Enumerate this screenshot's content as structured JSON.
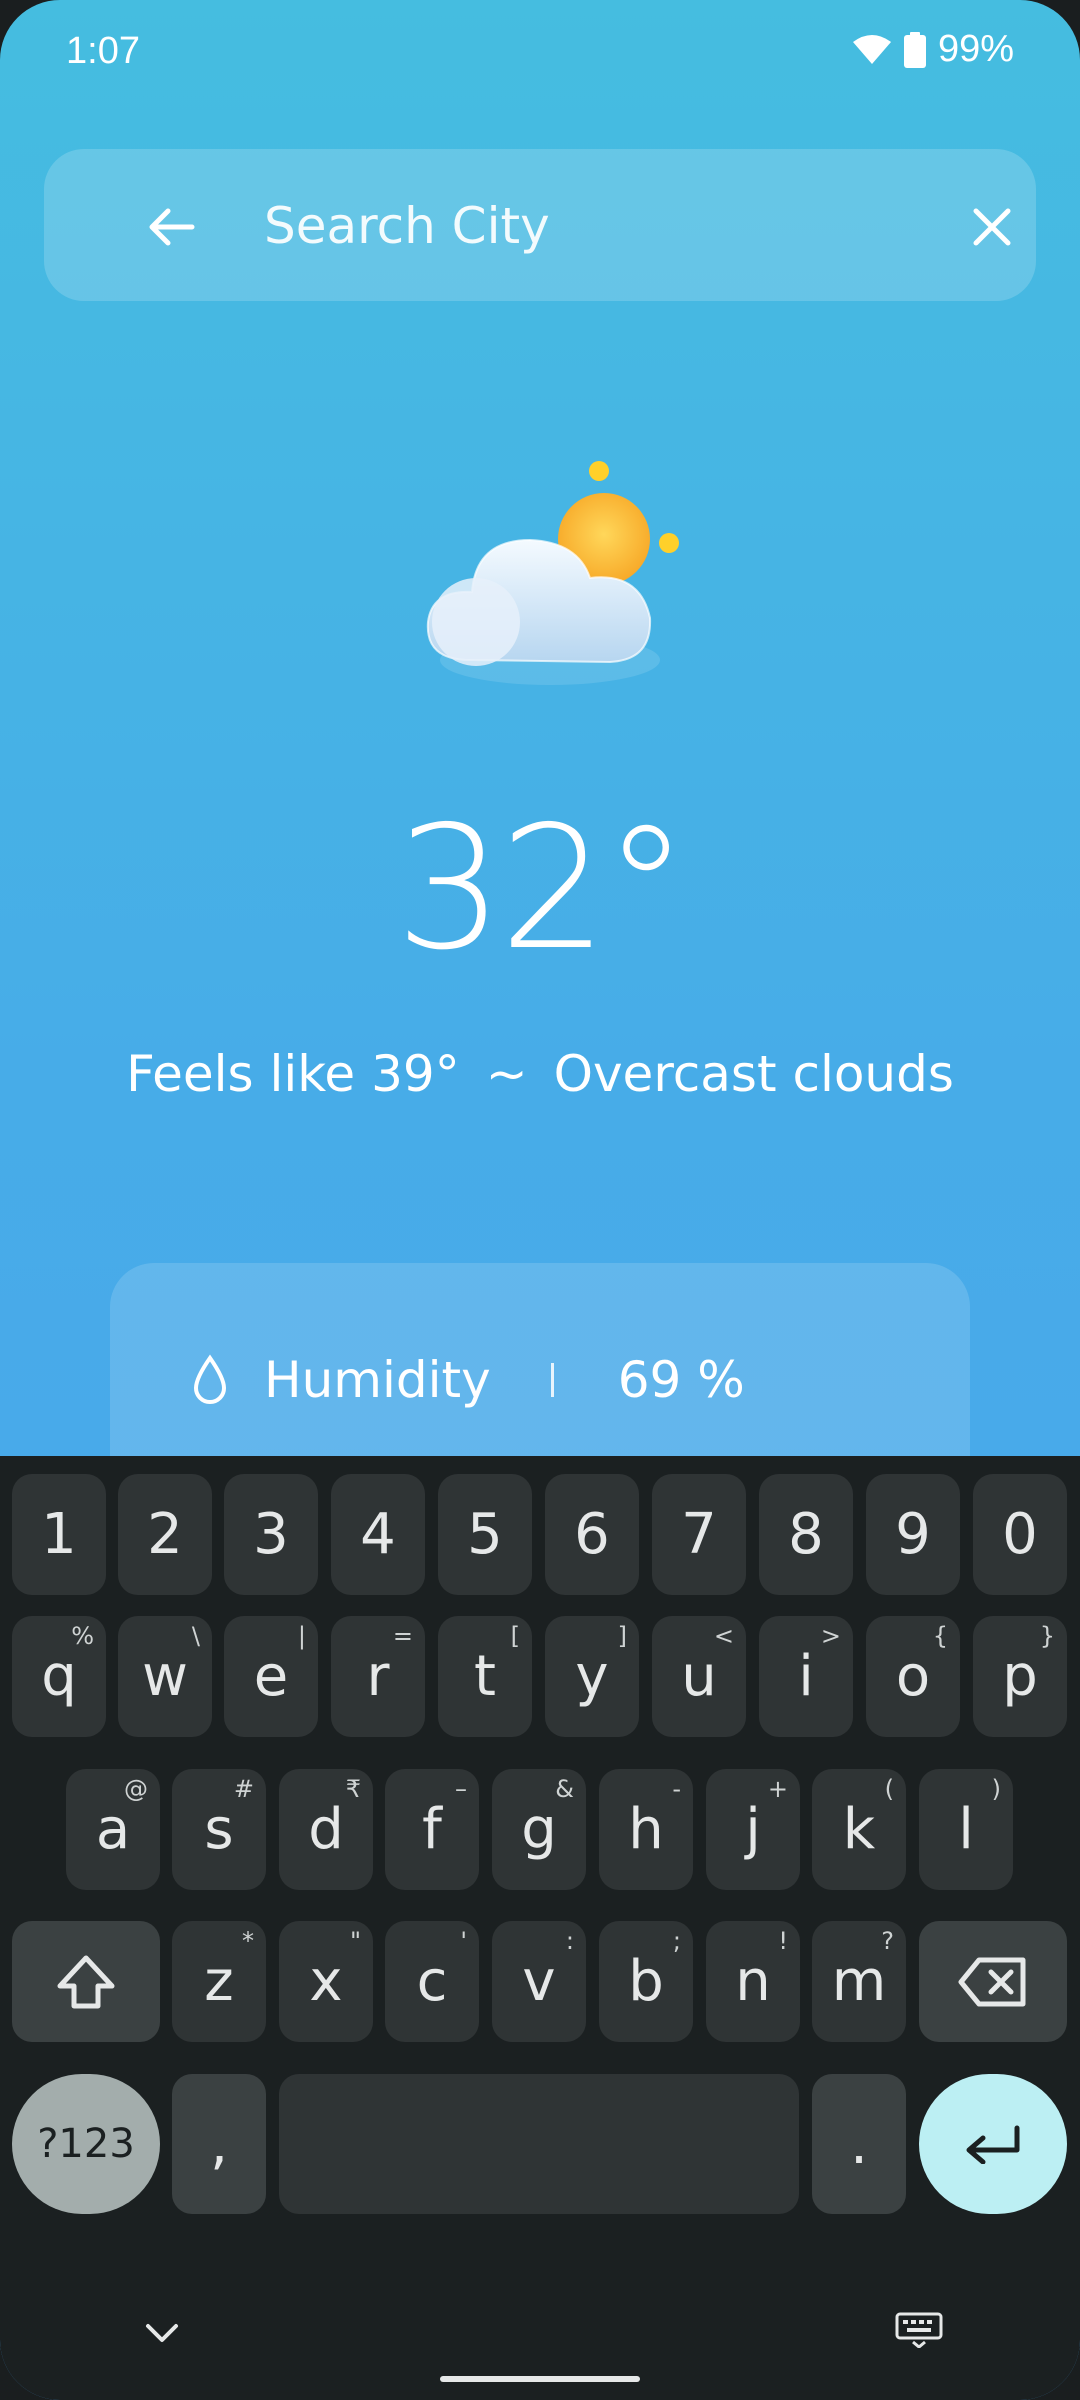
{
  "status_bar": {
    "time": "1:07",
    "battery": "99%"
  },
  "search": {
    "placeholder": "Search City",
    "value": ""
  },
  "weather": {
    "temperature": "32°",
    "feels_like": "Feels like 39°",
    "separator": "~",
    "condition": "Overcast clouds",
    "icon": "partly-cloudy-icon"
  },
  "details": {
    "humidity_label": "Humidity",
    "humidity_value": "69 %"
  },
  "keyboard": {
    "row1": [
      "1",
      "2",
      "3",
      "4",
      "5",
      "6",
      "7",
      "8",
      "9",
      "0"
    ],
    "row2": [
      {
        "key": "q",
        "hint": "%"
      },
      {
        "key": "w",
        "hint": "\\"
      },
      {
        "key": "e",
        "hint": "|"
      },
      {
        "key": "r",
        "hint": "="
      },
      {
        "key": "t",
        "hint": "["
      },
      {
        "key": "y",
        "hint": "]"
      },
      {
        "key": "u",
        "hint": "<"
      },
      {
        "key": "i",
        "hint": ">"
      },
      {
        "key": "o",
        "hint": "{"
      },
      {
        "key": "p",
        "hint": "}"
      }
    ],
    "row3": [
      {
        "key": "a",
        "hint": "@"
      },
      {
        "key": "s",
        "hint": "#"
      },
      {
        "key": "d",
        "hint": "₹"
      },
      {
        "key": "f",
        "hint": "–"
      },
      {
        "key": "g",
        "hint": "&"
      },
      {
        "key": "h",
        "hint": "-"
      },
      {
        "key": "j",
        "hint": "+"
      },
      {
        "key": "k",
        "hint": "("
      },
      {
        "key": "l",
        "hint": ")"
      }
    ],
    "row4": [
      {
        "key": "z",
        "hint": "*"
      },
      {
        "key": "x",
        "hint": "\""
      },
      {
        "key": "c",
        "hint": "'"
      },
      {
        "key": "v",
        "hint": ":"
      },
      {
        "key": "b",
        "hint": ";"
      },
      {
        "key": "n",
        "hint": "!"
      },
      {
        "key": "m",
        "hint": "?"
      }
    ],
    "mode_label": "?123",
    "comma": ",",
    "period": "."
  },
  "colors": {
    "accent_enter": "#bceff3",
    "sun": "#ffc83a",
    "keyboard_bg": "#1b2021"
  }
}
